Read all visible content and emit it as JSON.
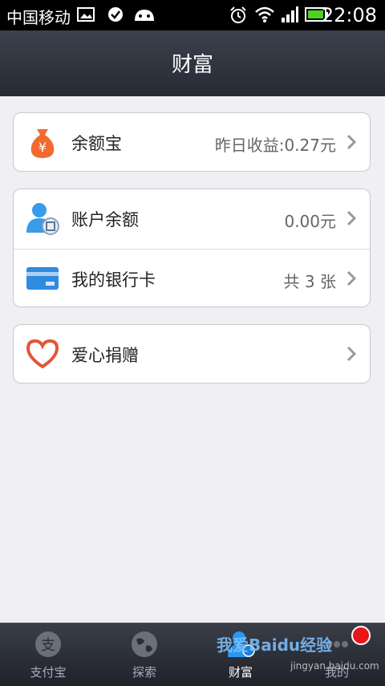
{
  "status_bar": {
    "carrier": "中国移动",
    "time": "22:08"
  },
  "header": {
    "title": "财富"
  },
  "sections": {
    "yuebao": {
      "label": "余额宝",
      "value": "昨日收益:0.27元"
    },
    "account": {
      "label": "账户余额",
      "value": "0.00元"
    },
    "bankcard": {
      "label": "我的银行卡",
      "value": "共 3 张"
    },
    "charity": {
      "label": "爱心捐赠"
    }
  },
  "tabs": {
    "alipay": "支付宝",
    "explore": "探索",
    "wealth": "财富",
    "more": "我的"
  },
  "watermark": {
    "text": "我爱Baidu经验",
    "url": "jingyan.baidu.com"
  },
  "colors": {
    "accent": "#2b98f0",
    "badge": "#e8151b",
    "moneybag": "#f26a2e"
  }
}
